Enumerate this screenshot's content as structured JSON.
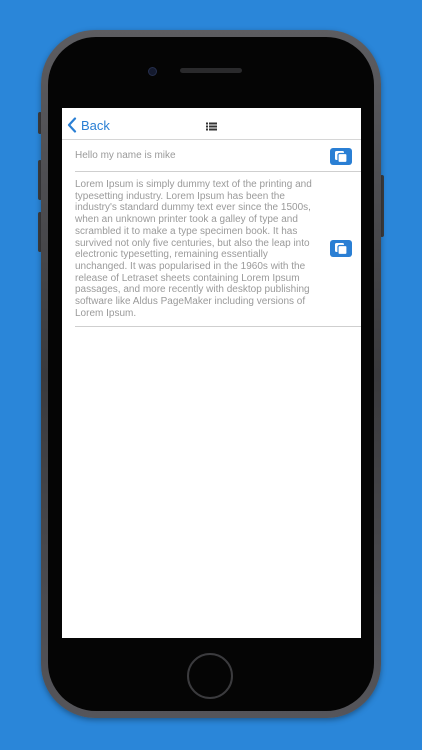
{
  "navbar": {
    "back_label": "Back"
  },
  "messages": [
    {
      "text": "Hello my name is mike"
    },
    {
      "text": "Lorem Ipsum is simply dummy text of the printing and typesetting industry. Lorem Ipsum has been the industry's standard dummy text ever since the 1500s, when an unknown printer took a galley of type and scrambled it to make a type specimen book. It has survived not only five centuries, but also the leap into electronic typesetting, remaining essentially unchanged. It was popularised in the 1960s with the release of Letraset sheets containing Lorem Ipsum passages, and more recently with desktop publishing software like Aldus PageMaker including versions of Lorem Ipsum."
    }
  ],
  "icons": {
    "back": "chevron-left-icon",
    "menu": "list-icon",
    "copy": "copy-icon"
  },
  "colors": {
    "background": "#2a86d9",
    "accent": "#2a7fd4",
    "text_muted": "#9a9a9a",
    "screen": "#ffffff"
  }
}
